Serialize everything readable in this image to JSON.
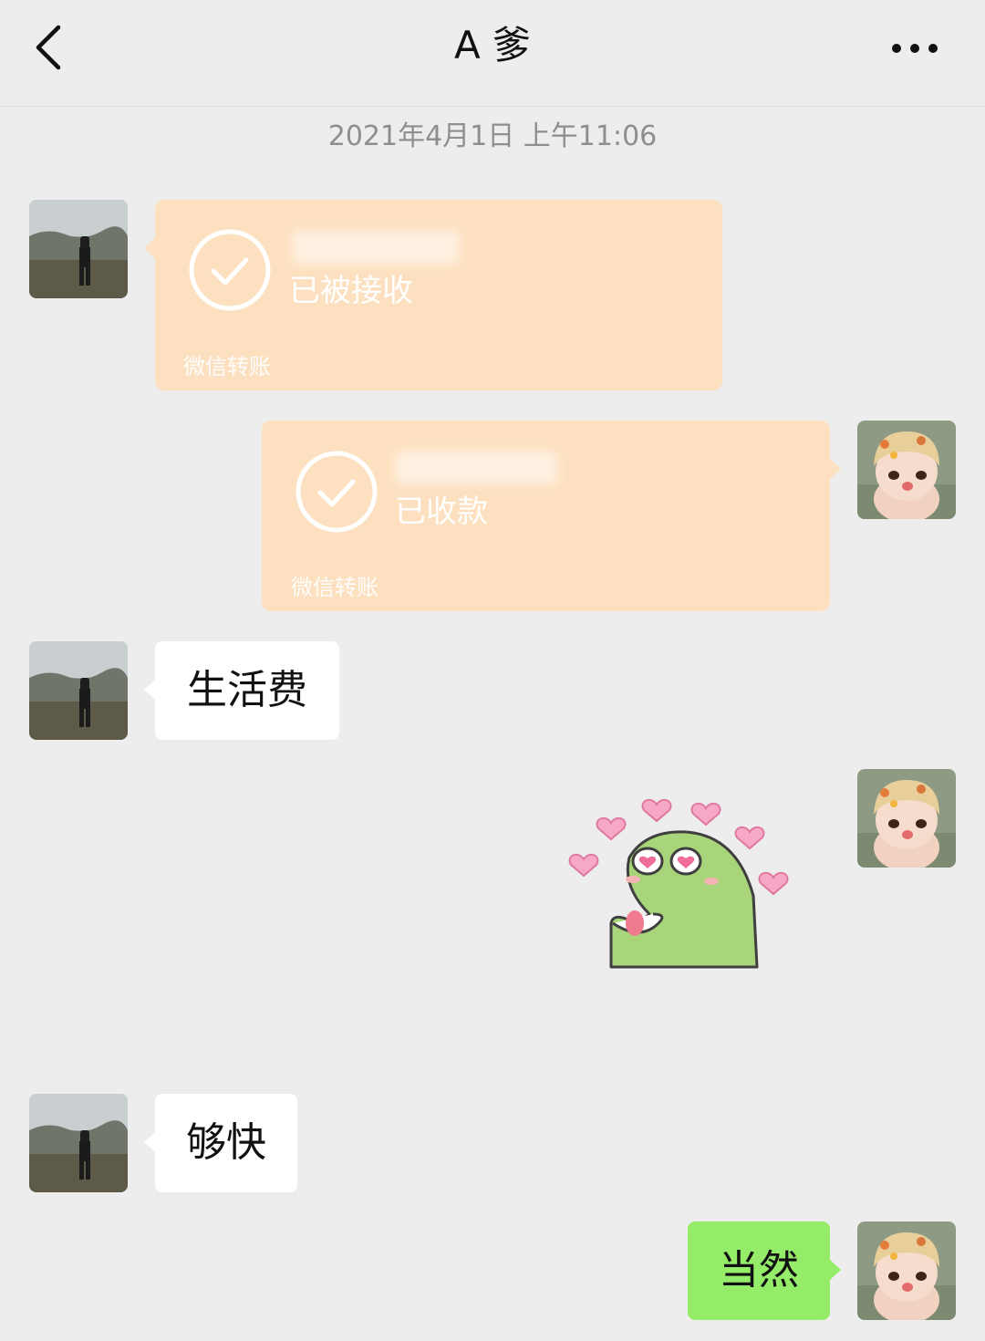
{
  "header": {
    "title": "A 爹",
    "back_icon": "chevron-left-icon",
    "more_icon": "ellipsis-icon"
  },
  "timestamp": "2021年4月1日 上午11:06",
  "messages": [
    {
      "side": "left",
      "type": "transfer",
      "status": "已被接收",
      "footer": "微信转账",
      "amount_hidden": true
    },
    {
      "side": "right",
      "type": "transfer",
      "status": "已收款",
      "footer": "微信转账",
      "amount_hidden": true
    },
    {
      "side": "left",
      "type": "text",
      "text": "生活费"
    },
    {
      "side": "right",
      "type": "sticker",
      "sticker": "green-dinosaur-heart-eyes-sticker"
    },
    {
      "side": "left",
      "type": "text",
      "text": "够快"
    },
    {
      "side": "right",
      "type": "text",
      "text": "当然"
    }
  ],
  "colors": {
    "background": "#ededed",
    "transfer_card": "#fde0bf",
    "sent_bubble": "#95ec69",
    "received_bubble": "#ffffff",
    "timestamp_text": "#8e8e8e"
  }
}
